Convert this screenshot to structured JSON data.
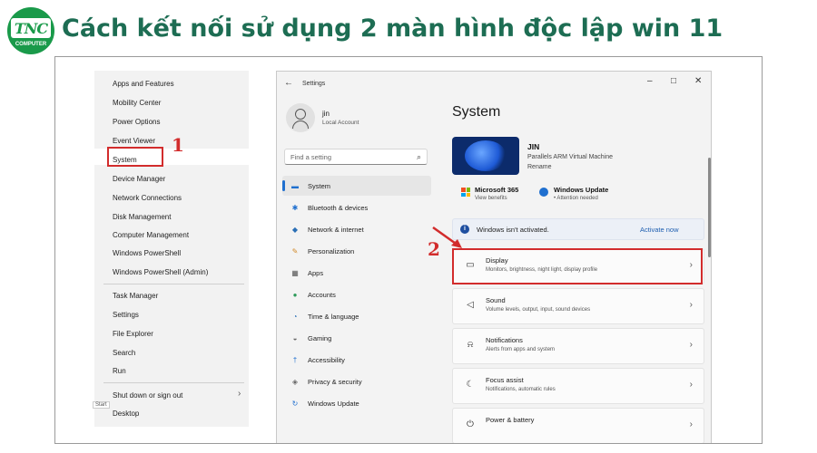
{
  "header": {
    "logo_text": "TNC",
    "logo_sub": "COMPUTER",
    "title": "Cách kết nối sử dụng 2 màn hình độc lập win 11"
  },
  "winx_menu": {
    "items_group1": [
      "Apps and Features",
      "Mobility Center",
      "Power Options",
      "Event Viewer",
      "System",
      "Device Manager",
      "Network Connections",
      "Disk Management",
      "Computer Management",
      "Windows PowerShell",
      "Windows PowerShell (Admin)"
    ],
    "items_group2": [
      "Task Manager",
      "Settings",
      "File Explorer",
      "Search",
      "Run"
    ],
    "items_group3": [
      "Shut down or sign out",
      "Desktop"
    ],
    "start_label": "Start"
  },
  "annotations": {
    "step1": "1",
    "step2": "2"
  },
  "settings": {
    "window_title": "Settings",
    "user": {
      "name": "jin",
      "account": "Local Account"
    },
    "search_placeholder": "Find a setting",
    "nav": [
      {
        "label": "System",
        "icon": "system-icon",
        "active": true
      },
      {
        "label": "Bluetooth & devices",
        "icon": "bluetooth-icon"
      },
      {
        "label": "Network & internet",
        "icon": "network-icon"
      },
      {
        "label": "Personalization",
        "icon": "personalization-icon"
      },
      {
        "label": "Apps",
        "icon": "apps-icon"
      },
      {
        "label": "Accounts",
        "icon": "accounts-icon"
      },
      {
        "label": "Time & language",
        "icon": "time-language-icon"
      },
      {
        "label": "Gaming",
        "icon": "gaming-icon"
      },
      {
        "label": "Accessibility",
        "icon": "accessibility-icon"
      },
      {
        "label": "Privacy & security",
        "icon": "privacy-icon"
      },
      {
        "label": "Windows Update",
        "icon": "windows-update-icon"
      }
    ],
    "page_title": "System",
    "device": {
      "name": "JIN",
      "model": "Parallels ARM Virtual Machine",
      "rename": "Rename"
    },
    "quick": [
      {
        "title": "Microsoft 365",
        "sub": "View benefits",
        "icon": "microsoft-365-icon"
      },
      {
        "title": "Windows Update",
        "sub": "• Attention needed",
        "icon": "windows-update-icon"
      }
    ],
    "activation": {
      "text": "Windows isn't activated.",
      "link": "Activate now"
    },
    "cards": [
      {
        "title": "Display",
        "sub": "Monitors, brightness, night light, display profile",
        "icon": "display-icon"
      },
      {
        "title": "Sound",
        "sub": "Volume levels, output, input, sound devices",
        "icon": "sound-icon"
      },
      {
        "title": "Notifications",
        "sub": "Alerts from apps and system",
        "icon": "notifications-icon"
      },
      {
        "title": "Focus assist",
        "sub": "Notifications, automatic rules",
        "icon": "focus-assist-icon"
      },
      {
        "title": "Power & battery",
        "sub": "",
        "icon": "power-icon"
      }
    ]
  },
  "colors": {
    "title_green": "#1d6d53",
    "annotation_red": "#d22c2c",
    "accent_blue": "#1f6fcf"
  }
}
